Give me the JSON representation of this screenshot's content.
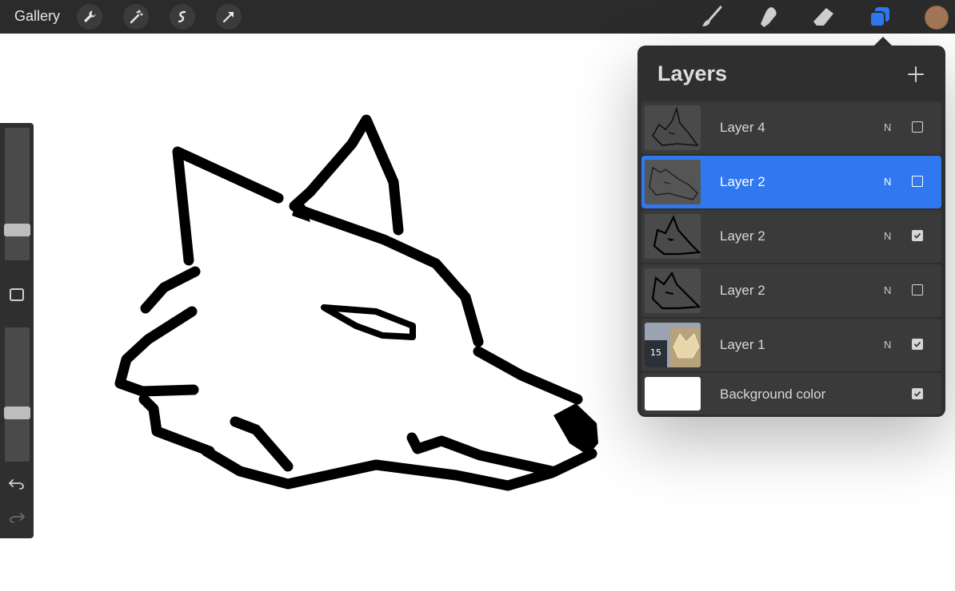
{
  "topbar": {
    "gallery_label": "Gallery",
    "left_tools": [
      "wrench-icon",
      "magic-wand-icon",
      "selection-icon",
      "transform-arrow-icon"
    ],
    "right_tools": [
      "brush-icon",
      "smudge-icon",
      "eraser-icon",
      "layers-icon"
    ],
    "active_tool": "layers-icon",
    "current_color": "#a27758"
  },
  "sidebar": {
    "brush_size_level": 0.2,
    "opacity_level": 0.35,
    "undo_icon": "undo-icon",
    "redo_icon": "redo-icon"
  },
  "layers_panel": {
    "title": "Layers",
    "add_icon": "plus-icon",
    "layers": [
      {
        "name": "Layer 4",
        "blend": "N",
        "visible": false,
        "selected": false
      },
      {
        "name": "Layer 2",
        "blend": "N",
        "visible": false,
        "selected": true
      },
      {
        "name": "Layer 2",
        "blend": "N",
        "visible": true,
        "selected": false
      },
      {
        "name": "Layer 2",
        "blend": "N",
        "visible": false,
        "selected": false
      },
      {
        "name": "Layer 1",
        "blend": "N",
        "visible": true,
        "selected": false,
        "thumb_text": "15"
      }
    ],
    "background": {
      "name": "Background color",
      "visible": true,
      "color": "#ffffff"
    }
  },
  "colors": {
    "accent": "#2f78f0",
    "panel": "#2f2f2f",
    "row": "#3a3a3a",
    "topbar": "#2b2b2b"
  }
}
